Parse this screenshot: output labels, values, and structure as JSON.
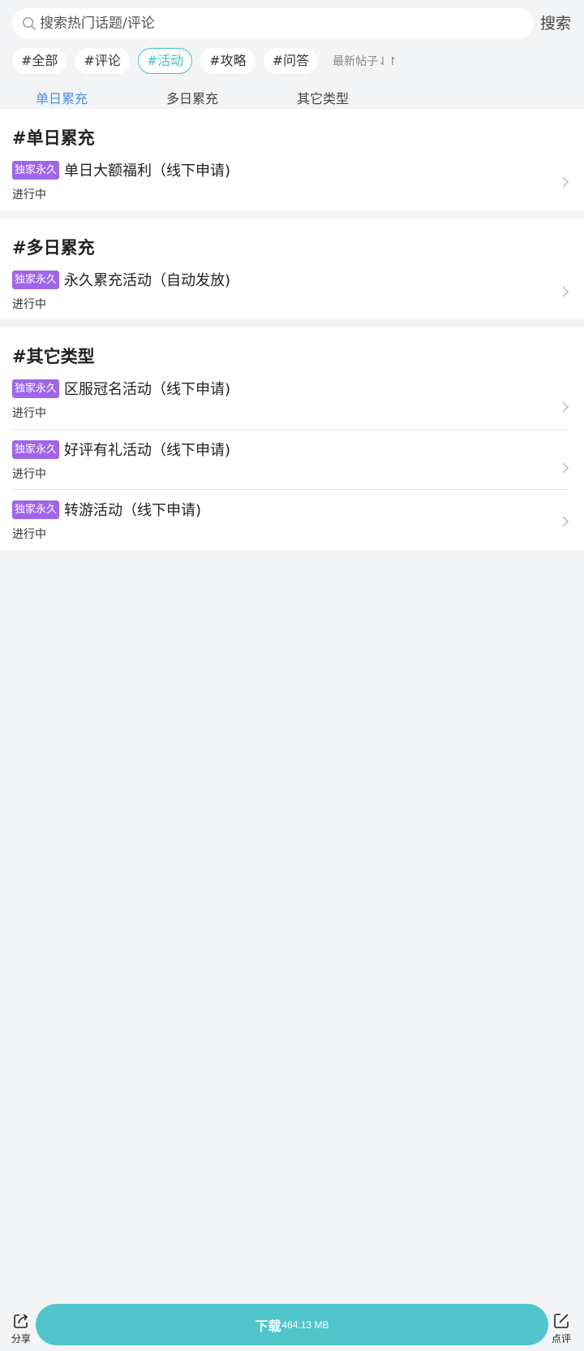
{
  "search": {
    "placeholder": "搜索热门话题/评论",
    "button_label": "搜索"
  },
  "tags": [
    "#全部",
    "#评论",
    "#活动",
    "#攻略",
    "#问答"
  ],
  "active_tag": "#活动",
  "sort": {
    "label": "最新帖子",
    "icon": "sort-arrows-icon"
  },
  "subtabs": [
    "单日累充",
    "多日累充",
    "其它类型"
  ],
  "active_subtab": "单日累充",
  "sections": [
    {
      "title": "#单日累充",
      "items": [
        {
          "badge": "独家永久",
          "title": "单日大额福利（线下申请)",
          "status": "进行中"
        }
      ]
    },
    {
      "title": "#多日累充",
      "items": [
        {
          "badge": "独家永久",
          "title": "永久累充活动（自动发放)",
          "status": "进行中"
        }
      ]
    },
    {
      "title": "#其它类型",
      "items": [
        {
          "badge": "独家永久",
          "title": "区服冠名活动（线下申请)",
          "status": "进行中"
        },
        {
          "badge": "独家永久",
          "title": "好评有礼活动（线下申请)",
          "status": "进行中"
        },
        {
          "badge": "独家永久",
          "title": "转游活动（线下申请)",
          "status": "进行中"
        }
      ]
    }
  ],
  "bottom": {
    "share_label": "分享",
    "download_label": "下载",
    "download_size": "464.13 MB",
    "review_label": "点评"
  },
  "colors": {
    "accent": "#3fc2c9",
    "tab_active": "#4a90e2",
    "badge": "#a066e8",
    "download": "#52c5cc"
  }
}
